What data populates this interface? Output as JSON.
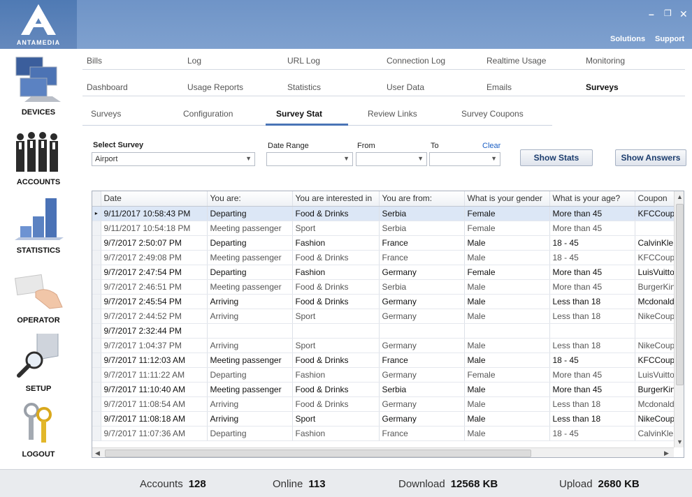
{
  "app": {
    "brand": "ANTAMEDIA",
    "minimize": "–",
    "maximize": "❐",
    "close": "✕",
    "top_menu": [
      "Solutions",
      "Support"
    ]
  },
  "sidebar": {
    "items": [
      {
        "label": "DEVICES",
        "icon": "devices-icon"
      },
      {
        "label": "ACCOUNTS",
        "icon": "accounts-icon"
      },
      {
        "label": "STATISTICS",
        "icon": "statistics-icon"
      },
      {
        "label": "OPERATOR",
        "icon": "operator-icon"
      },
      {
        "label": "SETUP",
        "icon": "setup-icon"
      },
      {
        "label": "LOGOUT",
        "icon": "logout-icon"
      }
    ]
  },
  "nav": {
    "row1": [
      "Bills",
      "Log",
      "URL Log",
      "Connection Log",
      "Realtime Usage",
      "Monitoring"
    ],
    "row2": [
      "Dashboard",
      "Usage Reports",
      "Statistics",
      "User Data",
      "Emails",
      "Surveys"
    ],
    "active": "Surveys"
  },
  "subnav": {
    "tabs": [
      "Surveys",
      "Configuration",
      "Survey Stat",
      "Review Links",
      "Survey Coupons"
    ],
    "active": "Survey Stat"
  },
  "filters": {
    "select_survey_label": "Select Survey",
    "select_survey_value": "Airport",
    "date_range_label": "Date Range",
    "date_range_value": "",
    "from_label": "From",
    "from_value": "",
    "to_label": "To",
    "to_value": "",
    "clear_label": "Clear",
    "show_stats": "Show Stats",
    "show_answers": "Show Answers"
  },
  "table": {
    "columns": [
      "Date",
      "You are:",
      "You are interested in",
      "You are from:",
      "What is your gender",
      "What is your age?",
      "Coupon"
    ],
    "rows": [
      {
        "bold": true,
        "selected": true,
        "cells": [
          "9/11/2017 10:58:43 PM",
          "Departing",
          "Food & Drinks",
          "Serbia",
          "Female",
          "More than 45",
          "KFCCoupon"
        ]
      },
      {
        "bold": false,
        "cells": [
          "9/11/2017 10:54:18 PM",
          "Meeting passenger",
          "Sport",
          "Serbia",
          "Female",
          "More than 45",
          ""
        ]
      },
      {
        "bold": true,
        "cells": [
          "9/7/2017 2:50:07 PM",
          "Departing",
          "Fashion",
          "France",
          "Male",
          "18 - 45",
          "CalvinKlein"
        ]
      },
      {
        "bold": false,
        "cells": [
          "9/7/2017 2:49:08 PM",
          "Meeting passenger",
          "Food & Drinks",
          "France",
          "Male",
          "18 - 45",
          "KFCCoupon"
        ]
      },
      {
        "bold": true,
        "cells": [
          "9/7/2017 2:47:54 PM",
          "Departing",
          "Fashion",
          "Germany",
          "Female",
          "More than 45",
          "LuisVuitton"
        ]
      },
      {
        "bold": false,
        "cells": [
          "9/7/2017 2:46:51 PM",
          "Meeting passenger",
          "Food & Drinks",
          "Serbia",
          "Male",
          "More than 45",
          "BurgerKing"
        ]
      },
      {
        "bold": true,
        "cells": [
          "9/7/2017 2:45:54 PM",
          "Arriving",
          "Food & Drinks",
          "Germany",
          "Male",
          "Less than 18",
          "Mcdonalds"
        ]
      },
      {
        "bold": false,
        "cells": [
          "9/7/2017 2:44:52 PM",
          "Arriving",
          "Sport",
          "Germany",
          "Male",
          "Less than 18",
          "NikeCoupon"
        ]
      },
      {
        "bold": true,
        "cells": [
          "9/7/2017 2:32:44 PM",
          "",
          "",
          "",
          "",
          "",
          ""
        ]
      },
      {
        "bold": false,
        "cells": [
          "9/7/2017 1:04:37 PM",
          "Arriving",
          "Sport",
          "Germany",
          "Male",
          "Less than 18",
          "NikeCoupon"
        ]
      },
      {
        "bold": true,
        "cells": [
          "9/7/2017 11:12:03 AM",
          "Meeting passenger",
          "Food & Drinks",
          "France",
          "Male",
          "18 - 45",
          "KFCCoupon"
        ]
      },
      {
        "bold": false,
        "cells": [
          "9/7/2017 11:11:22 AM",
          "Departing",
          "Fashion",
          "Germany",
          "Female",
          "More than 45",
          "LuisVuitton"
        ]
      },
      {
        "bold": true,
        "cells": [
          "9/7/2017 11:10:40 AM",
          "Meeting passenger",
          "Food & Drinks",
          "Serbia",
          "Male",
          "More than 45",
          "BurgerKing"
        ]
      },
      {
        "bold": false,
        "cells": [
          "9/7/2017 11:08:54 AM",
          "Arriving",
          "Food & Drinks",
          "Germany",
          "Male",
          "Less than 18",
          "Mcdonalds"
        ]
      },
      {
        "bold": true,
        "cells": [
          "9/7/2017 11:08:18 AM",
          "Arriving",
          "Sport",
          "Germany",
          "Male",
          "Less than 18",
          "NikeCoupon"
        ]
      },
      {
        "bold": false,
        "cells": [
          "9/7/2017 11:07:36 AM",
          "Departing",
          "Fashion",
          "France",
          "Male",
          "18 - 45",
          "CalvinKlein"
        ]
      }
    ]
  },
  "status": {
    "accounts_label": "Accounts",
    "accounts_value": "128",
    "online_label": "Online",
    "online_value": "113",
    "download_label": "Download",
    "download_value": "12568 KB",
    "upload_label": "Upload",
    "upload_value": "2680 KB"
  },
  "colors": {
    "header_blue": "#7fa1cf",
    "accent": "#4a74b6",
    "link": "#1b5fc4"
  }
}
